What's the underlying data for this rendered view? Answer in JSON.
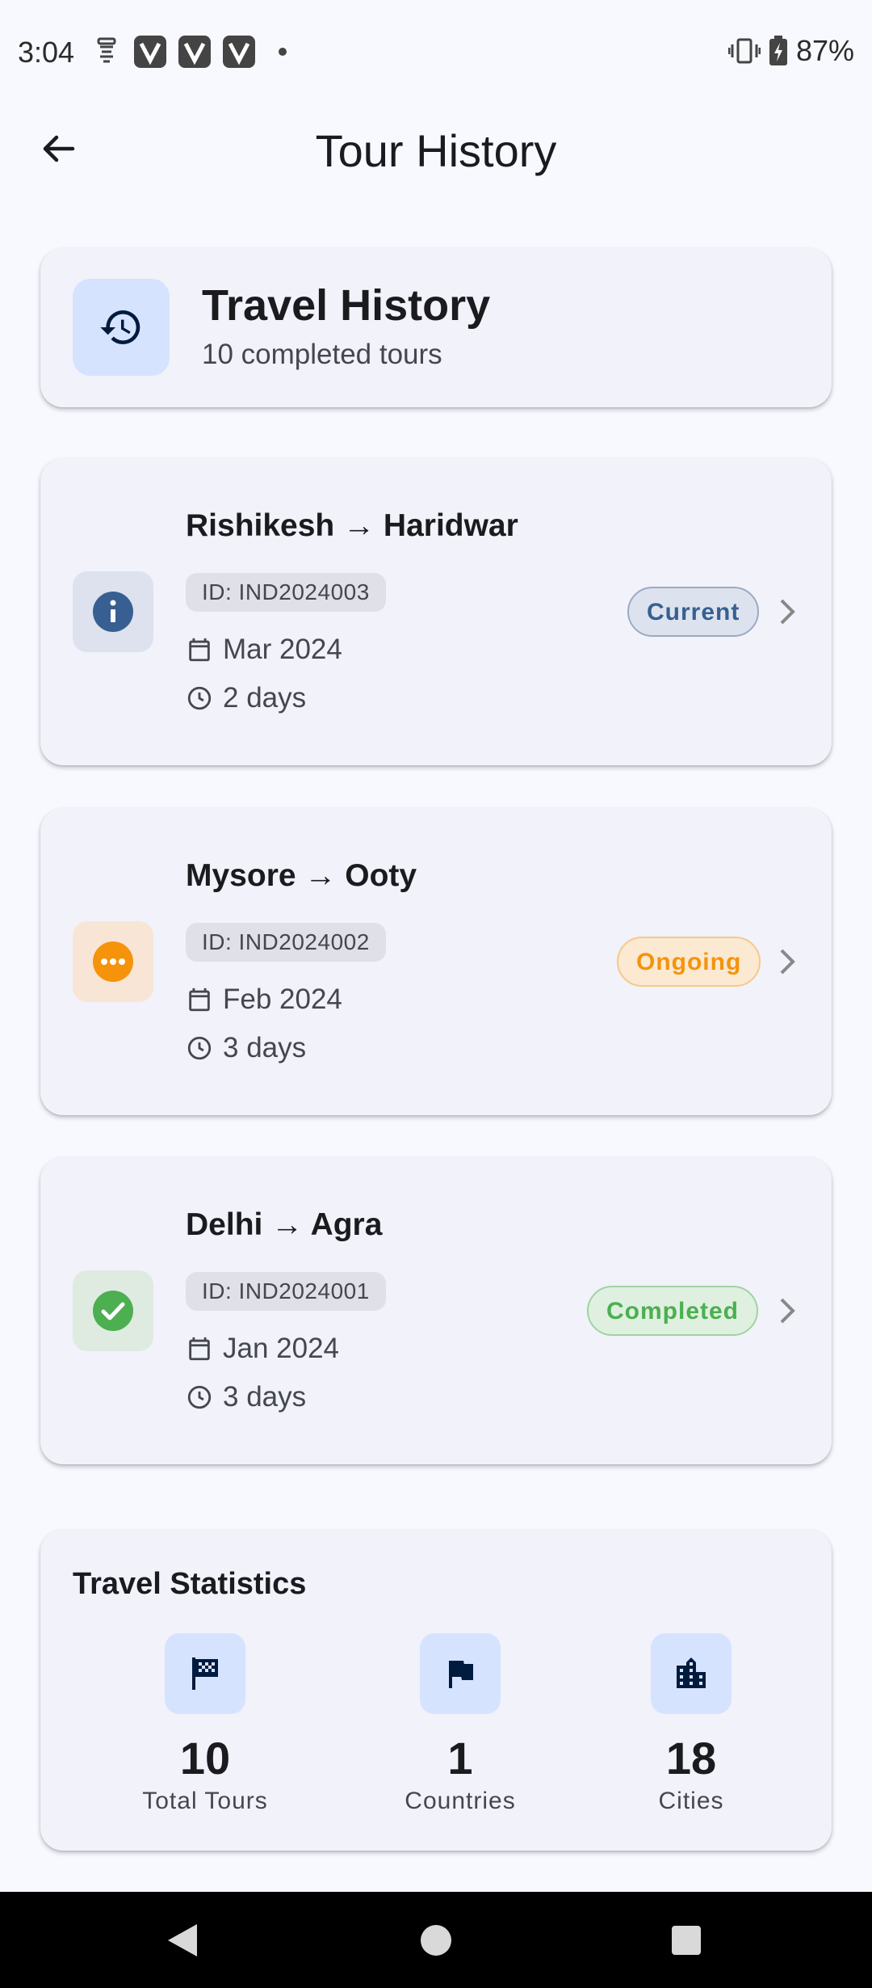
{
  "status_bar": {
    "time": "3:04",
    "battery": "87%",
    "icons": [
      "notification-icon",
      "v-app-icon",
      "v-app-icon",
      "v-app-icon",
      "dot-icon",
      "vibrate-icon",
      "battery-charging-icon"
    ]
  },
  "app_bar": {
    "title": "Tour History",
    "back_icon": "arrow-back-icon"
  },
  "summary": {
    "title": "Travel History",
    "subtitle": "10 completed tours",
    "icon": "history-icon"
  },
  "tours": [
    {
      "route": "Rishikesh → Haridwar",
      "id": "ID: IND2024003",
      "date": "Mar 2024",
      "duration": "2 days",
      "status": "Current",
      "status_icon": "info-icon",
      "color": "#375f91",
      "tint": "#dde2ee"
    },
    {
      "route": "Mysore → Ooty",
      "id": "ID: IND2024002",
      "date": "Feb 2024",
      "duration": "3 days",
      "status": "Ongoing",
      "status_icon": "more-horiz-icon",
      "color": "#f5930b",
      "tint": "#f8e5d6"
    },
    {
      "route": "Delhi → Agra",
      "id": "ID: IND2024001",
      "date": "Jan 2024",
      "duration": "3 days",
      "status": "Completed",
      "status_icon": "check-circle-icon",
      "color": "#4caf50",
      "tint": "#dfeae1"
    }
  ],
  "stats": {
    "title": "Travel Statistics",
    "items": [
      {
        "value": "10",
        "label": "Total Tours",
        "icon": "tour-flag-icon"
      },
      {
        "value": "1",
        "label": "Countries",
        "icon": "flag-icon"
      },
      {
        "value": "18",
        "label": "Cities",
        "icon": "city-icon"
      }
    ]
  },
  "colors": {
    "background": "#f8f9ff",
    "card": "#f1f2fa",
    "primary_container": "#d6e3ff",
    "on_primary_container": "#001b3e"
  }
}
